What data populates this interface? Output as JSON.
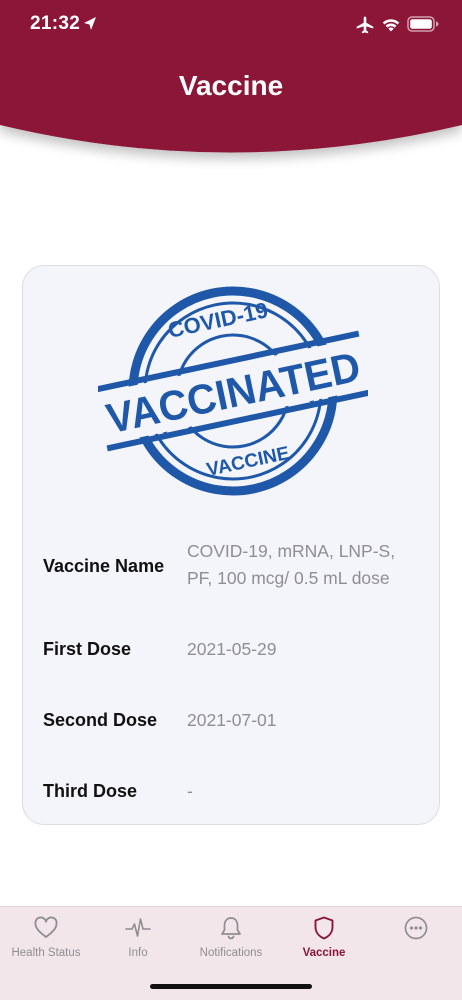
{
  "status_bar": {
    "time": "21:32"
  },
  "header": {
    "title": "Vaccine"
  },
  "stamp": {
    "top_text": "COVID-19",
    "main_text": "VACCINATED",
    "bottom_text": "VACCINE",
    "color": "#1f58a8"
  },
  "details": [
    {
      "label": "Vaccine Name",
      "value_line1": "COVID-19, mRNA, LNP-S,",
      "value_line2": "PF, 100 mcg/ 0.5 mL dose"
    },
    {
      "label": "First Dose",
      "value": "2021-05-29"
    },
    {
      "label": "Second Dose",
      "value": "2021-07-01"
    },
    {
      "label": "Third Dose",
      "value": "-"
    }
  ],
  "tabs": [
    {
      "label": "Health Status",
      "icon": "heart-icon",
      "active": false
    },
    {
      "label": "Info",
      "icon": "pulse-icon",
      "active": false
    },
    {
      "label": "Notifications",
      "icon": "bell-icon",
      "active": false
    },
    {
      "label": "Vaccine",
      "icon": "shield-icon",
      "active": true
    },
    {
      "label": "",
      "icon": "more-icon",
      "active": false
    }
  ],
  "colors": {
    "brand": "#8b1538",
    "tab_bar_bg": "#f3e6ea",
    "card_bg": "#f4f5fa",
    "muted_text": "#8e8e93"
  }
}
